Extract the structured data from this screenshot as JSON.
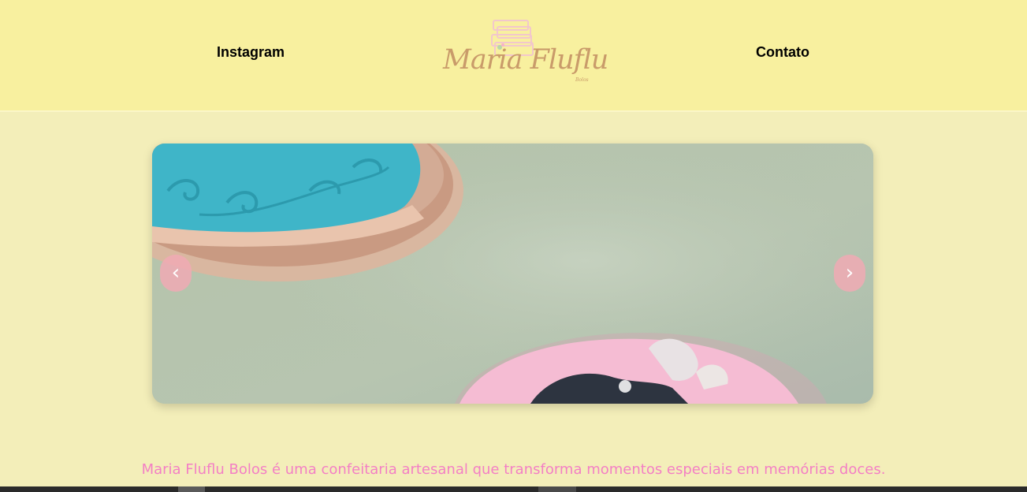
{
  "header": {
    "nav_left": "Instagram",
    "nav_right": "Contato",
    "logo": {
      "title": "Maria Fluflu",
      "subtitle": "Bolos"
    }
  },
  "carousel": {
    "prev_label": "‹",
    "next_label": "›"
  },
  "about": {
    "text": "Maria Fluflu Bolos é uma confeitaria artesanal que transforma momentos especiais em memórias doces."
  },
  "colors": {
    "header_bg": "#f8f09f",
    "page_bg": "#f3eeb9",
    "accent_pink": "#f37fc5",
    "logo_gold": "#c99b6a"
  }
}
